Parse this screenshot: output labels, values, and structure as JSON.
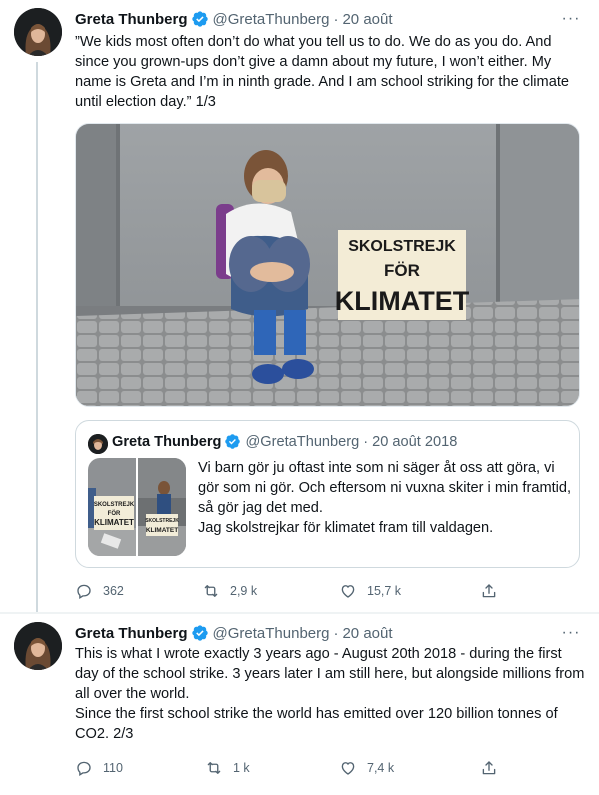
{
  "tweets": [
    {
      "author": "Greta Thunberg",
      "handle": "@GretaThunberg",
      "separator": "·",
      "date": "20 août",
      "text": "”We kids most often don’t do what you tell us to do. We do as you do. And since you grown-ups don’t give a damn about my future, I won’t either. My name is Greta and I’m in ninth grade. And I am school striking for the climate until election day.” 1/3",
      "photo_sign": [
        "SKOLSTREJK",
        "FÖR",
        "KLIMATET"
      ],
      "quote": {
        "author": "Greta Thunberg",
        "handle": "@GretaThunberg",
        "separator": "·",
        "date": "20 août 2018",
        "text": "Vi barn gör ju oftast inte som ni säger åt oss att göra, vi gör som ni gör. Och eftersom ni vuxna skiter i min framtid, så gör jag det med.\nJag skolstrejkar för klimatet fram till valdagen.",
        "thumb_sign": [
          "SKOLSTREJK",
          "FÖR",
          "KLIMATET"
        ]
      },
      "replies": "362",
      "retweets": "2,9 k",
      "likes": "15,7 k"
    },
    {
      "author": "Greta Thunberg",
      "handle": "@GretaThunberg",
      "separator": "·",
      "date": "20 août",
      "text": "This is what I wrote exactly 3 years ago - August 20th 2018 - during the first day of the school strike. 3 years later I am still here, but alongside millions from all over the world.\nSince the first school strike the world has emitted over 120 billion tonnes of CO2. 2/3",
      "replies": "110",
      "retweets": "1 k",
      "likes": "7,4 k"
    }
  ],
  "more_icon": "···",
  "colors": {
    "verified": "#1d9bf0",
    "muted": "#536471",
    "border": "#cfd9de"
  }
}
